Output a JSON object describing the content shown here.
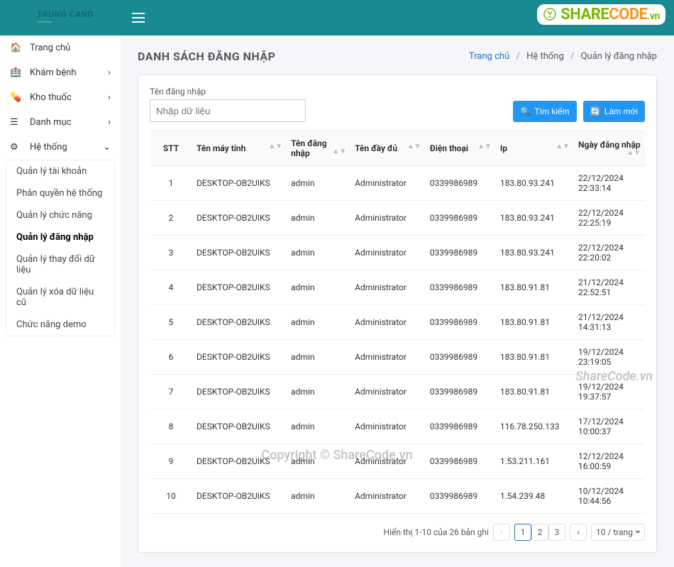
{
  "brand": {
    "line1": "TRUNG CANG",
    "line2": "———"
  },
  "sidebar": {
    "items": [
      {
        "icon": "home",
        "label": "Trang chủ"
      },
      {
        "icon": "hospital",
        "label": "Khám bệnh"
      },
      {
        "icon": "pill",
        "label": "Kho thuốc"
      },
      {
        "icon": "list",
        "label": "Danh mục"
      },
      {
        "icon": "gear",
        "label": "Hệ thống"
      }
    ],
    "submenu": [
      "Quản lý tài khoản",
      "Phân quyền hệ thống",
      "Quản lý chức năng",
      "Quản lý đăng nhập",
      "Quản lý thay đổi dữ liệu",
      "Quản lý xóa dữ liệu cũ",
      "Chức năng demo"
    ],
    "submenu_active_index": 3
  },
  "header": {
    "title": "DANH SÁCH ĐĂNG NHẬP",
    "breadcrumb": {
      "home": "Trang chủ",
      "section": "Hệ thống",
      "page": "Quản lý đăng nhập"
    }
  },
  "filter": {
    "username_label": "Tên đăng nhập",
    "username_placeholder": "Nhập dữ liệu",
    "search_btn": "Tìm kiếm",
    "refresh_btn": "Làm mới"
  },
  "table": {
    "headers": {
      "stt": "STT",
      "computer": "Tên máy tính",
      "username": "Tên đăng nhập",
      "fullname": "Tên đầy đủ",
      "phone": "Điện thoại",
      "ip": "Ip",
      "login_date": "Ngày đăng nhập"
    },
    "rows": [
      {
        "stt": "1",
        "computer": "DESKTOP-OB2UIKS",
        "username": "admin",
        "fullname": "Administrator",
        "phone": "0339986989",
        "ip": "183.80.93.241",
        "date": "22/12/2024 22:33:14"
      },
      {
        "stt": "2",
        "computer": "DESKTOP-OB2UIKS",
        "username": "admin",
        "fullname": "Administrator",
        "phone": "0339986989",
        "ip": "183.80.93.241",
        "date": "22/12/2024 22:25:19"
      },
      {
        "stt": "3",
        "computer": "DESKTOP-OB2UIKS",
        "username": "admin",
        "fullname": "Administrator",
        "phone": "0339986989",
        "ip": "183.80.93.241",
        "date": "22/12/2024 22:20:02"
      },
      {
        "stt": "4",
        "computer": "DESKTOP-OB2UIKS",
        "username": "admin",
        "fullname": "Administrator",
        "phone": "0339986989",
        "ip": "183.80.91.81",
        "date": "21/12/2024 22:52:51"
      },
      {
        "stt": "5",
        "computer": "DESKTOP-OB2UIKS",
        "username": "admin",
        "fullname": "Administrator",
        "phone": "0339986989",
        "ip": "183.80.91.81",
        "date": "21/12/2024 14:31:13"
      },
      {
        "stt": "6",
        "computer": "DESKTOP-OB2UIKS",
        "username": "admin",
        "fullname": "Administrator",
        "phone": "0339986989",
        "ip": "183.80.91.81",
        "date": "19/12/2024 23:19:05"
      },
      {
        "stt": "7",
        "computer": "DESKTOP-OB2UIKS",
        "username": "admin",
        "fullname": "Administrator",
        "phone": "0339986989",
        "ip": "183.80.91.81",
        "date": "19/12/2024 19:37:57"
      },
      {
        "stt": "8",
        "computer": "DESKTOP-OB2UIKS",
        "username": "admin",
        "fullname": "Administrator",
        "phone": "0339986989",
        "ip": "116.78.250.133",
        "date": "17/12/2024 10:00:37"
      },
      {
        "stt": "9",
        "computer": "DESKTOP-OB2UIKS",
        "username": "admin",
        "fullname": "Administrator",
        "phone": "0339986989",
        "ip": "1.53.211.161",
        "date": "12/12/2024 16:00:59"
      },
      {
        "stt": "10",
        "computer": "DESKTOP-OB2UIKS",
        "username": "admin",
        "fullname": "Administrator",
        "phone": "0339986989",
        "ip": "1.54.239.48",
        "date": "10/12/2024 10:44:56"
      }
    ]
  },
  "pagination": {
    "summary": "Hiển thị 1-10 của 26 bản ghi",
    "pages": [
      "1",
      "2",
      "3"
    ],
    "active_page": "1",
    "per_page": "10 / trang"
  },
  "watermarks": {
    "top": {
      "s": "SHARE",
      "c": "CODE",
      "vn": ".vn"
    },
    "mid": "ShareCode.vn",
    "bot": "Copyright © ShareCode.vn"
  }
}
